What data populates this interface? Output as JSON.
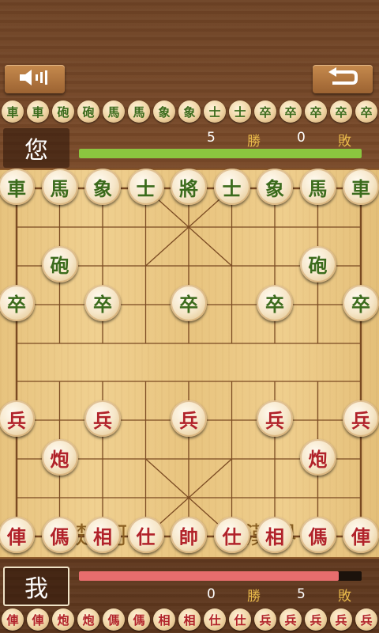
{
  "toolbar": {
    "sound_icon": "speaker-volume-icon",
    "undo_icon": "undo-arrow-icon"
  },
  "captured_by_opponent": [
    "車",
    "車",
    "砲",
    "砲",
    "馬",
    "馬",
    "象",
    "象",
    "士",
    "士",
    "卒",
    "卒",
    "卒",
    "卒",
    "卒"
  ],
  "captured_by_me": [
    "俥",
    "俥",
    "炮",
    "炮",
    "傌",
    "傌",
    "相",
    "相",
    "仕",
    "仕",
    "兵",
    "兵",
    "兵",
    "兵",
    "兵"
  ],
  "opponent": {
    "name": "您",
    "wins": "5",
    "wins_label": "勝",
    "losses": "0",
    "losses_label": "敗",
    "progress": 1.0,
    "bar_color": "#8bc63f"
  },
  "me": {
    "name": "我",
    "wins": "0",
    "wins_label": "勝",
    "losses": "5",
    "losses_label": "敗",
    "progress": 0.92,
    "bar_color": "#e76d6d"
  },
  "river": {
    "left": "楚河",
    "right": "漢界"
  },
  "board_pieces": [
    {
      "label": "車",
      "side": "black",
      "file": 0,
      "rank": 0
    },
    {
      "label": "馬",
      "side": "black",
      "file": 1,
      "rank": 0
    },
    {
      "label": "象",
      "side": "black",
      "file": 2,
      "rank": 0
    },
    {
      "label": "士",
      "side": "black",
      "file": 3,
      "rank": 0
    },
    {
      "label": "將",
      "side": "black",
      "file": 4,
      "rank": 0
    },
    {
      "label": "士",
      "side": "black",
      "file": 5,
      "rank": 0
    },
    {
      "label": "象",
      "side": "black",
      "file": 6,
      "rank": 0
    },
    {
      "label": "馬",
      "side": "black",
      "file": 7,
      "rank": 0
    },
    {
      "label": "車",
      "side": "black",
      "file": 8,
      "rank": 0
    },
    {
      "label": "砲",
      "side": "black",
      "file": 1,
      "rank": 2
    },
    {
      "label": "砲",
      "side": "black",
      "file": 7,
      "rank": 2
    },
    {
      "label": "卒",
      "side": "black",
      "file": 0,
      "rank": 3
    },
    {
      "label": "卒",
      "side": "black",
      "file": 2,
      "rank": 3
    },
    {
      "label": "卒",
      "side": "black",
      "file": 4,
      "rank": 3
    },
    {
      "label": "卒",
      "side": "black",
      "file": 6,
      "rank": 3
    },
    {
      "label": "卒",
      "side": "black",
      "file": 8,
      "rank": 3
    },
    {
      "label": "兵",
      "side": "red",
      "file": 0,
      "rank": 6
    },
    {
      "label": "兵",
      "side": "red",
      "file": 2,
      "rank": 6
    },
    {
      "label": "兵",
      "side": "red",
      "file": 4,
      "rank": 6
    },
    {
      "label": "兵",
      "side": "red",
      "file": 6,
      "rank": 6
    },
    {
      "label": "兵",
      "side": "red",
      "file": 8,
      "rank": 6
    },
    {
      "label": "炮",
      "side": "red",
      "file": 1,
      "rank": 7
    },
    {
      "label": "炮",
      "side": "red",
      "file": 7,
      "rank": 7
    },
    {
      "label": "俥",
      "side": "red",
      "file": 0,
      "rank": 9
    },
    {
      "label": "傌",
      "side": "red",
      "file": 1,
      "rank": 9
    },
    {
      "label": "相",
      "side": "red",
      "file": 2,
      "rank": 9
    },
    {
      "label": "仕",
      "side": "red",
      "file": 3,
      "rank": 9
    },
    {
      "label": "帥",
      "side": "red",
      "file": 4,
      "rank": 9
    },
    {
      "label": "仕",
      "side": "red",
      "file": 5,
      "rank": 9
    },
    {
      "label": "相",
      "side": "red",
      "file": 6,
      "rank": 9
    },
    {
      "label": "傌",
      "side": "red",
      "file": 7,
      "rank": 9
    },
    {
      "label": "俥",
      "side": "red",
      "file": 8,
      "rank": 9
    }
  ]
}
